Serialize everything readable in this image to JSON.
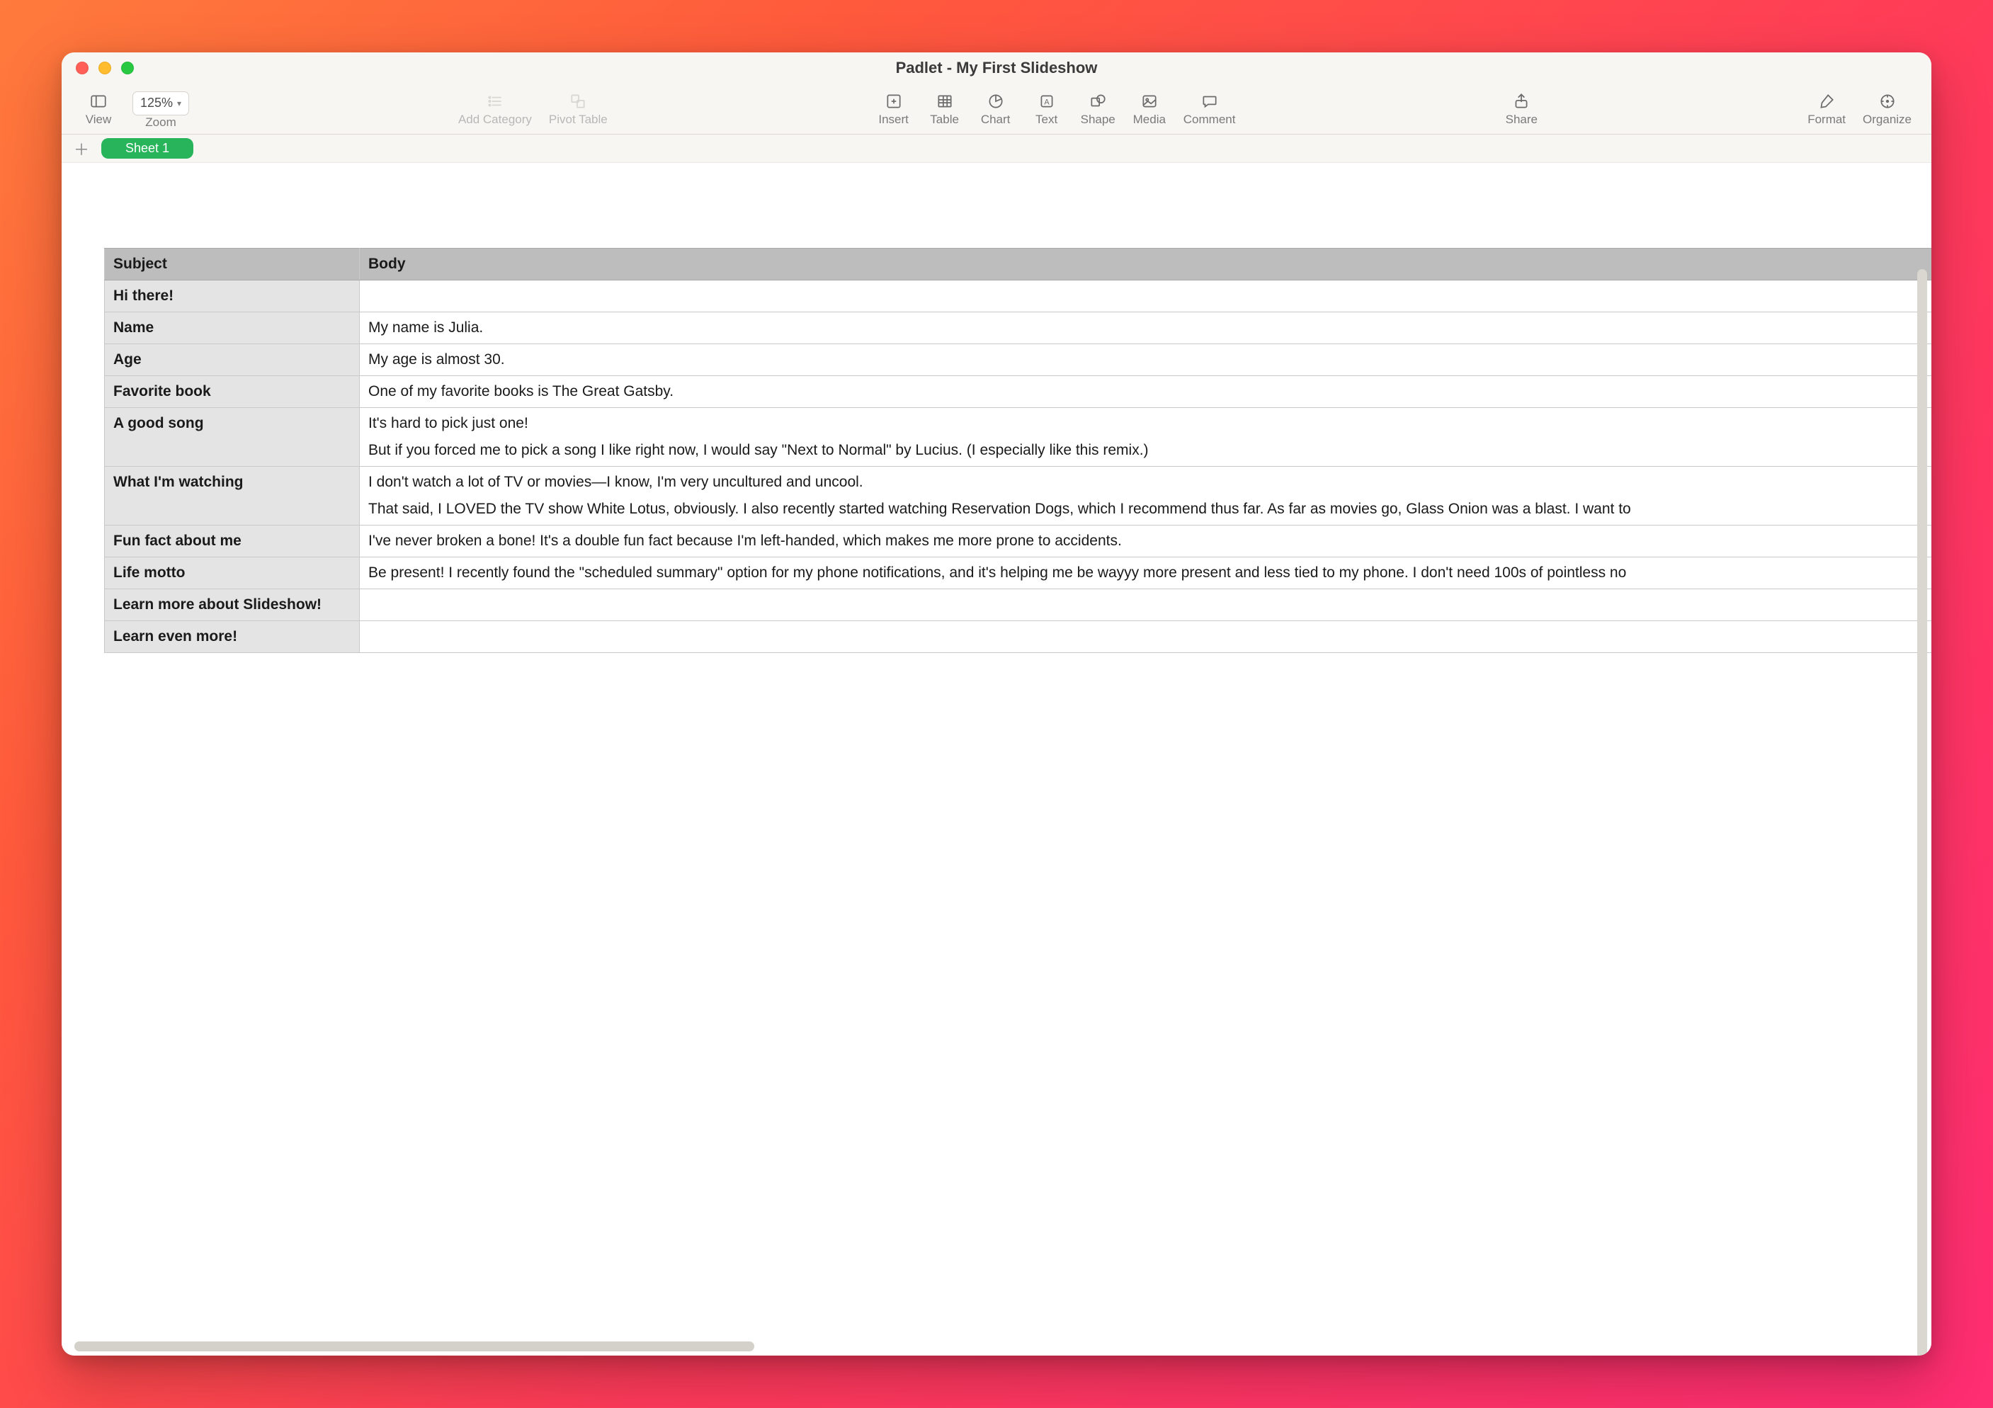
{
  "window": {
    "title": "Padlet - My First Slideshow"
  },
  "traffic_lights": {
    "close": "#ff5f57",
    "min": "#febc2e",
    "max": "#28c840"
  },
  "toolbar": {
    "view": "View",
    "zoom_label": "Zoom",
    "zoom_value": "125%",
    "add_category": "Add Category",
    "pivot_table": "Pivot Table",
    "insert": "Insert",
    "table": "Table",
    "chart": "Chart",
    "text": "Text",
    "shape": "Shape",
    "media": "Media",
    "comment": "Comment",
    "share": "Share",
    "format": "Format",
    "organize": "Organize"
  },
  "sheets": {
    "add_tooltip": "+",
    "tab1": "Sheet 1"
  },
  "table": {
    "headers": {
      "subject": "Subject",
      "body": "Body"
    },
    "rows": [
      {
        "subject": "Hi there!",
        "body": ""
      },
      {
        "subject": "Name",
        "body": "My name is Julia."
      },
      {
        "subject": "Age",
        "body": "My age is almost 30."
      },
      {
        "subject": "Favorite book",
        "body": "One of my favorite books is The Great Gatsby."
      },
      {
        "subject": "A good song",
        "body_multi": [
          "It's hard to pick just one!",
          "But if you forced me to pick a song I like right now, I would say \"Next to Normal\" by Lucius. (I especially like this remix.)"
        ]
      },
      {
        "subject": "What I'm watching",
        "body_multi": [
          "I don't watch a lot of TV or movies—I know, I'm very uncultured and uncool.",
          "That said, I LOVED the TV show White Lotus, obviously. I also recently started watching Reservation Dogs, which I recommend thus far. As far as movies go, Glass Onion was a blast. I want to"
        ]
      },
      {
        "subject": "Fun fact about me",
        "body": "I've never broken a bone! It's a double fun fact because I'm left-handed, which makes me more prone to accidents."
      },
      {
        "subject": "Life motto",
        "body": "Be present! I recently found the \"scheduled summary\" option for my phone notifications, and it's helping me be wayyy more present and less tied to my phone. I don't need 100s of pointless no"
      },
      {
        "subject": "Learn more about Slideshow!",
        "body": ""
      },
      {
        "subject": "Learn even more!",
        "body": ""
      }
    ]
  }
}
